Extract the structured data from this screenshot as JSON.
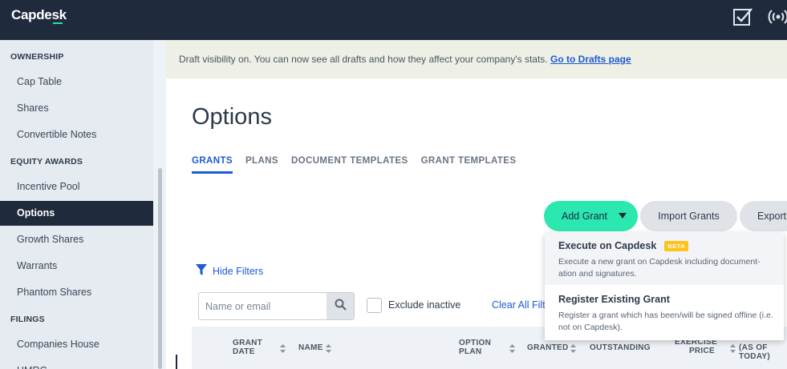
{
  "topbar": {
    "logo": "Capdesk",
    "icons": [
      "checklist-icon",
      "broadcast-icon"
    ]
  },
  "sidebar": {
    "sections": [
      {
        "label": "OWNERSHIP",
        "items": [
          "Cap Table",
          "Shares",
          "Convertible Notes"
        ]
      },
      {
        "label": "EQUITY AWARDS",
        "items": [
          "Incentive Pool",
          "Options",
          "Growth Shares",
          "Warrants",
          "Phantom Shares"
        ]
      },
      {
        "label": "FILINGS",
        "items": [
          "Companies House",
          "HMRC"
        ]
      }
    ],
    "active_item": "Options"
  },
  "banner": {
    "text": "Draft visibility on. You can now see all drafts and how they affect your company's stats.",
    "link": "Go to Drafts page"
  },
  "page": {
    "title": "Options"
  },
  "tabs": [
    {
      "label": "GRANTS",
      "active": true
    },
    {
      "label": "PLANS",
      "active": false
    },
    {
      "label": "DOCUMENT TEMPLATES",
      "active": false
    },
    {
      "label": "GRANT TEMPLATES",
      "active": false
    }
  ],
  "actions": {
    "add_grant": "Add Grant",
    "import_grants": "Import Grants",
    "export": "Export"
  },
  "filters": {
    "toggle_label": "Hide Filters",
    "search_placeholder": "Name or email",
    "search_value": "",
    "exclude_inactive_label": "Exclude inactive",
    "exclude_inactive_checked": false,
    "clear_label": "Clear All Filters"
  },
  "table": {
    "columns": [
      {
        "label": "GRANT DATE",
        "sortable": true
      },
      {
        "label": "NAME",
        "sortable": true
      },
      {
        "label": "OPTION PLAN",
        "sortable": true
      },
      {
        "label": "GRANTED",
        "sortable": true
      },
      {
        "label": "OUTSTANDING",
        "sortable": false
      },
      {
        "label": "EXERCISE PRICE",
        "sortable": true
      },
      {
        "label": "(AS OF TODAY)",
        "sortable": false
      }
    ]
  },
  "dropdown": {
    "items": [
      {
        "title": "Execute on Capdesk",
        "badge": "BETA",
        "description": "Execute a new grant on Capdesk including document-ation and signatures."
      },
      {
        "title": "Register Existing Grant",
        "badge": "",
        "description": "Register a grant which has been/will be signed offline (i.e. not on Capdesk)."
      }
    ]
  },
  "colors": {
    "topbar": "#1f2a3c",
    "accent": "#2be8b0",
    "link": "#1e5ad0",
    "badge": "#ffc21a",
    "sidebar": "#e6ebf1"
  }
}
